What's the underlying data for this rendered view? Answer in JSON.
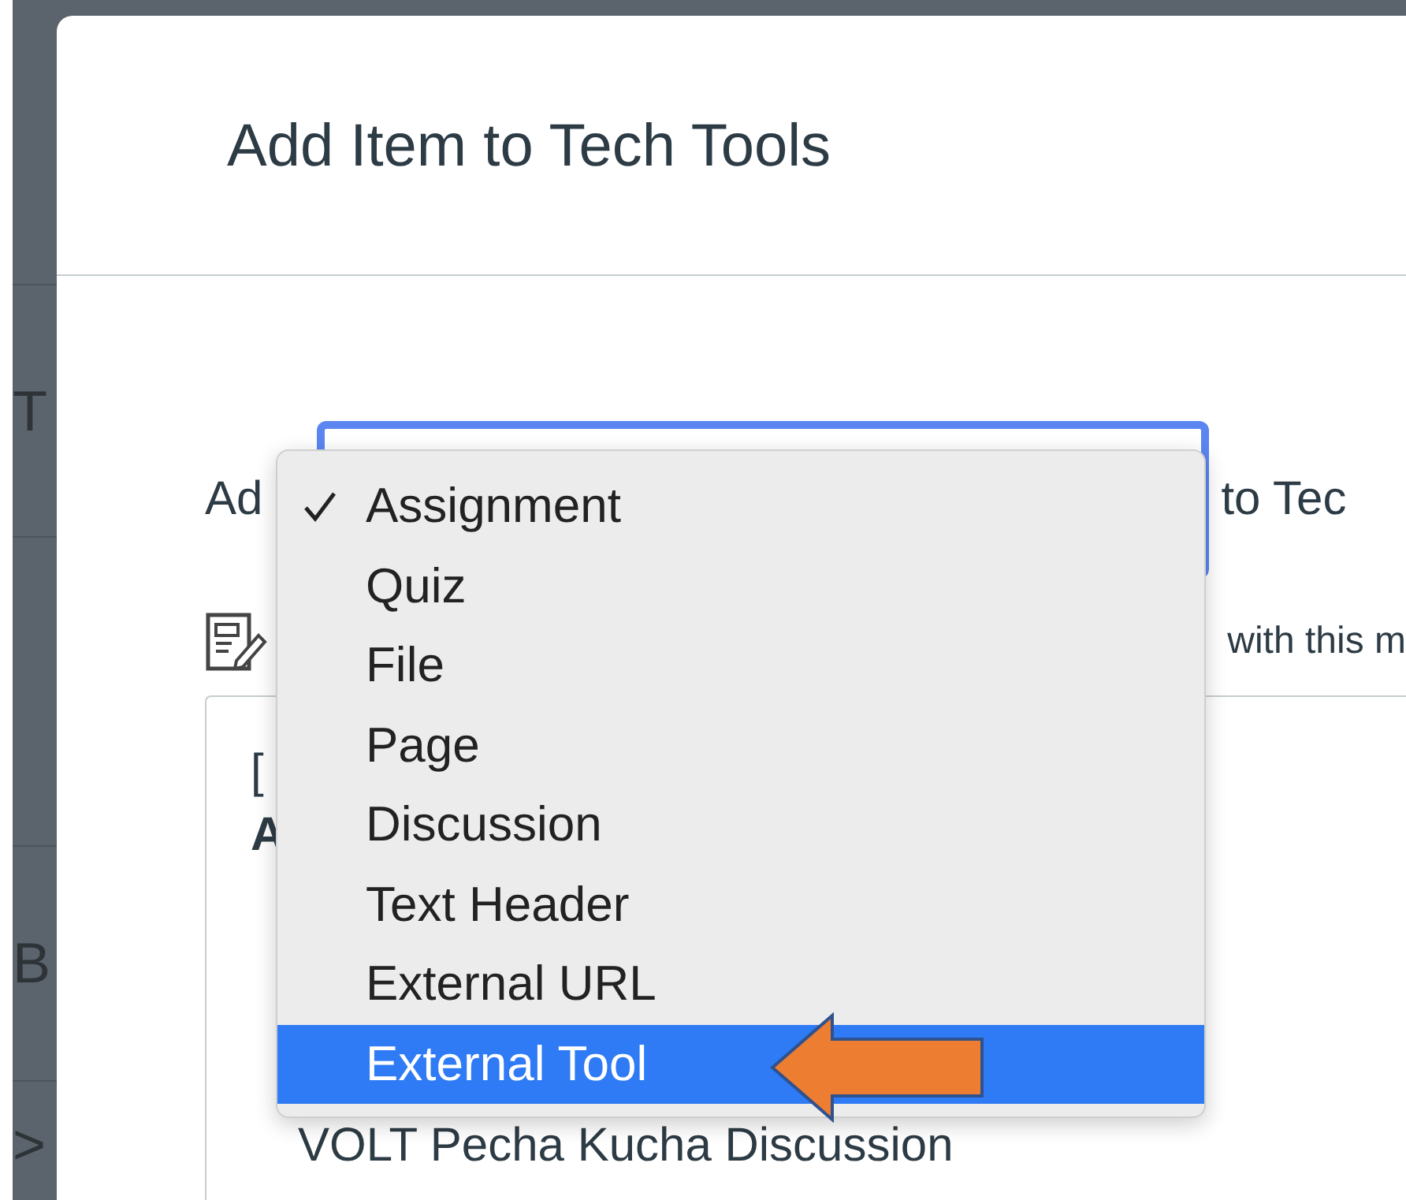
{
  "sidebar": {
    "items": [
      "T",
      "B",
      ">"
    ]
  },
  "dialog": {
    "title": "Add Item to Tech Tools",
    "add_label": "Ad",
    "target_label": "to Tec",
    "hint": "with this m",
    "list": {
      "lines": [
        "[",
        "A"
      ],
      "items": [
        "VOLT Pecha Kucha Discussion"
      ]
    }
  },
  "menu": {
    "items": [
      {
        "label": "Assignment",
        "checked": true,
        "selected": false
      },
      {
        "label": "Quiz",
        "checked": false,
        "selected": false
      },
      {
        "label": "File",
        "checked": false,
        "selected": false
      },
      {
        "label": "Page",
        "checked": false,
        "selected": false
      },
      {
        "label": "Discussion",
        "checked": false,
        "selected": false
      },
      {
        "label": "Text Header",
        "checked": false,
        "selected": false
      },
      {
        "label": "External URL",
        "checked": false,
        "selected": false
      },
      {
        "label": "External Tool",
        "checked": false,
        "selected": true
      }
    ]
  }
}
